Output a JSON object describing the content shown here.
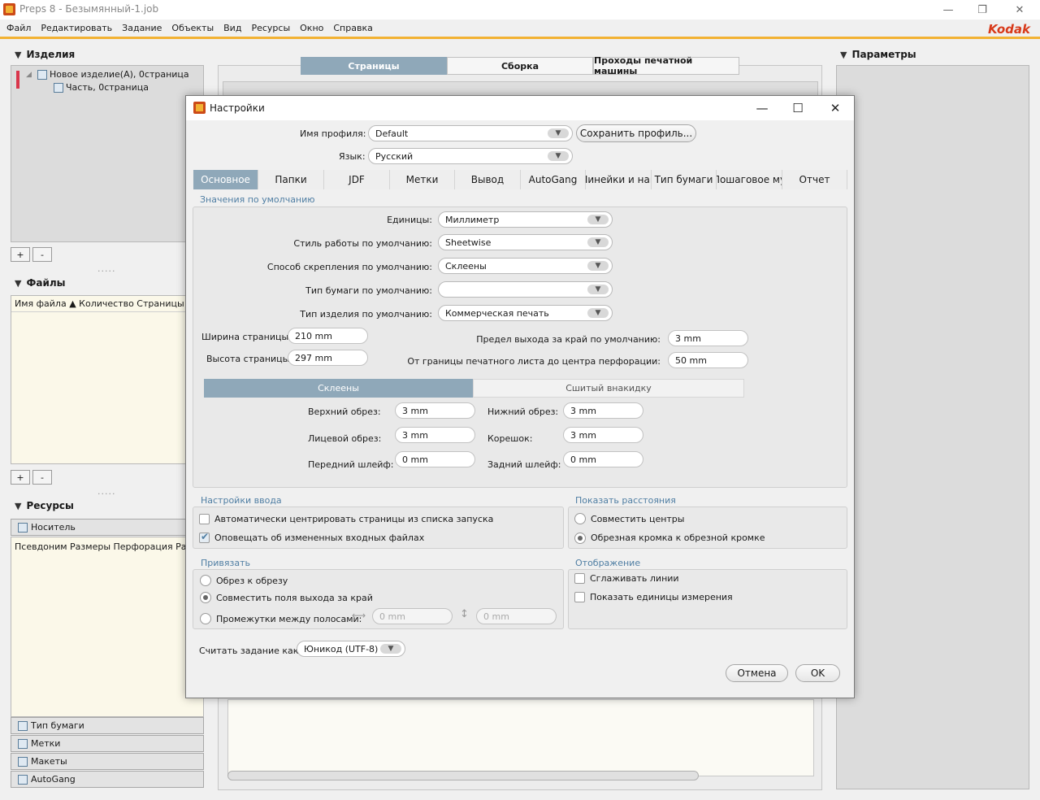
{
  "app": {
    "title": "Preps 8 - Безымянный-1.job",
    "window_controls": {
      "minimize": "—",
      "restore": "❐",
      "close": "✕"
    },
    "brand": "Kodak"
  },
  "menu": [
    "Файл",
    "Редактировать",
    "Задание",
    "Объекты",
    "Вид",
    "Ресурсы",
    "Окно",
    "Справка"
  ],
  "left": {
    "products": {
      "title": "Изделия",
      "tree": [
        "Новое изделие(А), 0страница",
        "Часть, 0страница"
      ],
      "add": "+",
      "remove": "-"
    },
    "files": {
      "title": "Файлы",
      "columns": "Имя файла ▲ Количество Страницы Обр",
      "add": "+",
      "remove": "-"
    },
    "resources": {
      "title": "Ресурсы",
      "tab_media": "Носитель",
      "columns": "Псевдоним Размеры Перфорация Размер",
      "tabs": [
        "Тип бумаги",
        "Метки",
        "Макеты",
        "AutoGang"
      ]
    },
    "grip": "....."
  },
  "center_tabs": [
    "Страницы",
    "Сборка",
    "Проходы печатной машины"
  ],
  "right": {
    "title": "Параметры"
  },
  "dialog": {
    "title": "Настройки",
    "profile_label": "Имя профиля:",
    "profile_value": "Default",
    "save_profile": "Сохранить профиль...",
    "language_label": "Язык:",
    "language_value": "Русский",
    "tabs": [
      "Основное",
      "Папки",
      "JDF",
      "Метки",
      "Вывод",
      "AutoGang",
      "Линейки и нап",
      "Тип бумаги",
      "Пошаговое му",
      "Отчет"
    ],
    "defaults": {
      "title": "Значения по умолчанию",
      "units_label": "Единицы:",
      "units_value": "Миллиметр",
      "workstyle_label": "Стиль работы по умолчанию:",
      "workstyle_value": "Sheetwise",
      "binding_label": "Способ скрепления по умолчанию:",
      "binding_value": "Склеены",
      "paper_label": "Тип бумаги по умолчанию:",
      "paper_value": "",
      "product_label": "Тип изделия по умолчанию:",
      "product_value": "Коммерческая печать",
      "page_width_label": "Ширина страницы:",
      "page_width_value": "210 mm",
      "page_height_label": "Высота страницы:",
      "page_height_value": "297 mm",
      "bleed_label": "Предел выхода за край по умолчанию:",
      "bleed_value": "3 mm",
      "perf_label": "От границы печатного листа до центра перфорации:",
      "perf_value": "50 mm",
      "binding_tabs": [
        "Склеены",
        "Сшитый внакидку"
      ],
      "top_trim_label": "Верхний обрез:",
      "top_trim_value": "3 mm",
      "bottom_trim_label": "Нижний обрез:",
      "bottom_trim_value": "3 mm",
      "face_trim_label": "Лицевой обрез:",
      "face_trim_value": "3 mm",
      "spine_label": "Корешок:",
      "spine_value": "3 mm",
      "front_lip_label": "Передний шлейф:",
      "front_lip_value": "0 mm",
      "back_lip_label": "Задний шлейф:",
      "back_lip_value": "0 mm"
    },
    "input": {
      "title": "Настройки ввода",
      "auto_center": "Автоматически центрировать страницы из списка запуска",
      "notify_changes": "Оповещать об измененных входных файлах"
    },
    "distances": {
      "title": "Показать расстояния",
      "align_centers": "Совместить центры",
      "trim_to_trim": "Обрезная кромка к обрезной кромке"
    },
    "snap": {
      "title": "Привязать",
      "to_trim": "Обрез к обрезу",
      "align_bleed": "Совместить поля выхода за край",
      "gutters": "Промежутки между полосами:",
      "h_value": "0 mm",
      "v_value": "0 mm"
    },
    "display": {
      "title": "Отображение",
      "smooth": "Сглаживать линии",
      "show_units": "Показать единицы измерения"
    },
    "read_as_label": "Считать задание как",
    "read_as_value": "Юникод (UTF-8)",
    "cancel": "Отмена",
    "ok": "OK"
  }
}
